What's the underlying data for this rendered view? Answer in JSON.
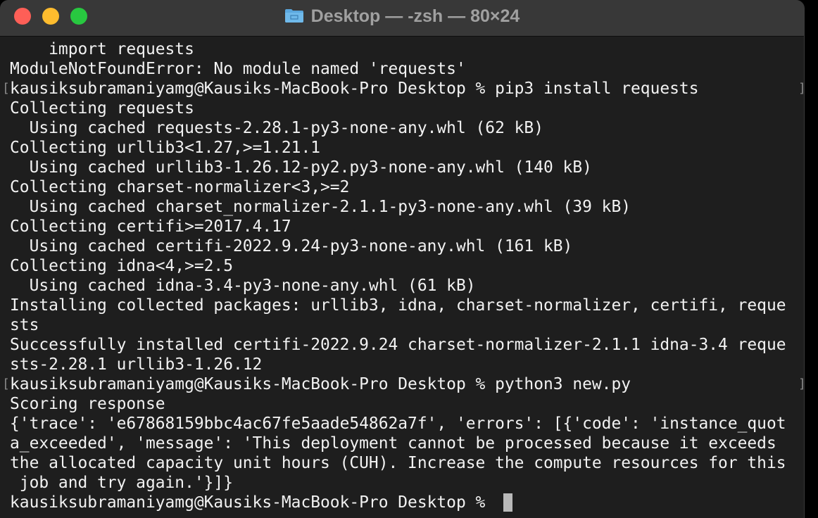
{
  "window": {
    "title": "Desktop — -zsh — 80×24"
  },
  "terminal": {
    "lines": [
      "    import requests",
      "ModuleNotFoundError: No module named 'requests'",
      "kausiksubramaniyamg@Kausiks-MacBook-Pro Desktop % pip3 install requests",
      "Collecting requests",
      "  Using cached requests-2.28.1-py3-none-any.whl (62 kB)",
      "Collecting urllib3<1.27,>=1.21.1",
      "  Using cached urllib3-1.26.12-py2.py3-none-any.whl (140 kB)",
      "Collecting charset-normalizer<3,>=2",
      "  Using cached charset_normalizer-2.1.1-py3-none-any.whl (39 kB)",
      "Collecting certifi>=2017.4.17",
      "  Using cached certifi-2022.9.24-py3-none-any.whl (161 kB)",
      "Collecting idna<4,>=2.5",
      "  Using cached idna-3.4-py3-none-any.whl (61 kB)",
      "Installing collected packages: urllib3, idna, charset-normalizer, certifi, reque",
      "sts",
      "Successfully installed certifi-2022.9.24 charset-normalizer-2.1.1 idna-3.4 reque",
      "sts-2.28.1 urllib3-1.26.12",
      "kausiksubramaniyamg@Kausiks-MacBook-Pro Desktop % python3 new.py",
      "Scoring response",
      "{'trace': 'e67868159bbc4ac67fe5aade54862a7f', 'errors': [{'code': 'instance_quot",
      "a_exceeded', 'message': 'This deployment cannot be processed because it exceeds",
      "the allocated capacity unit hours (CUH). Increase the compute resources for this",
      " job and try again.'}]}",
      "kausiksubramaniyamg@Kausiks-MacBook-Pro Desktop % "
    ],
    "mark_left": "[",
    "mark_right": "]"
  },
  "colors": {
    "background": "#1e1e1e",
    "titlebar": "#383838",
    "text": "#f2f2f2",
    "close": "#fe5f57",
    "minimize": "#febc2e",
    "maximize": "#28c840"
  },
  "icons": {
    "title": "folder-icon"
  }
}
